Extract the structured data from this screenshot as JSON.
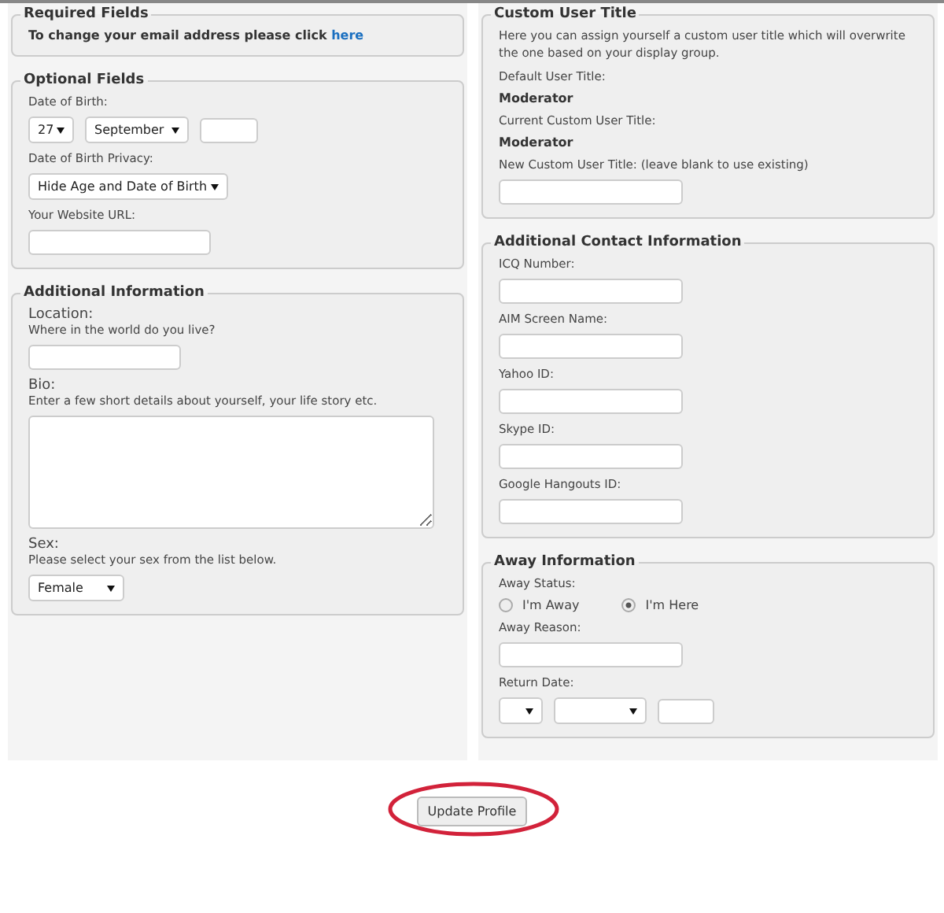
{
  "required_fields": {
    "legend": "Required Fields",
    "text": "To change your email address please click",
    "link": "here"
  },
  "optional_fields": {
    "legend": "Optional Fields",
    "dob_label": "Date of Birth:",
    "dob_day": "27",
    "dob_month": "September",
    "privacy_label": "Date of Birth Privacy:",
    "privacy_value": "Hide Age and Date of Birth",
    "website_label": "Your Website URL:"
  },
  "additional_information": {
    "legend": "Additional Information",
    "location_label": "Location:",
    "location_hint": "Where in the world do you live?",
    "bio_label": "Bio:",
    "bio_hint": "Enter a few short details about yourself, your life story etc.",
    "sex_label": "Sex:",
    "sex_hint": "Please select your sex from the list below.",
    "sex_value": "Female"
  },
  "custom_user_title": {
    "legend": "Custom User Title",
    "description": "Here you can assign yourself a custom user title which will overwrite the one based on your display group.",
    "default_label": "Default User Title:",
    "default_value": "Moderator",
    "current_label": "Current Custom User Title:",
    "current_value": "Moderator",
    "new_label": "New Custom User Title: (leave blank to use existing)"
  },
  "additional_contact_information": {
    "legend": "Additional Contact Information",
    "fields": [
      {
        "label": "ICQ Number:"
      },
      {
        "label": "AIM Screen Name:"
      },
      {
        "label": "Yahoo ID:"
      },
      {
        "label": "Skype ID:"
      },
      {
        "label": "Google Hangouts ID:"
      }
    ]
  },
  "away_information": {
    "legend": "Away Information",
    "status_label": "Away Status:",
    "options": [
      {
        "label": "I'm Away",
        "selected": false
      },
      {
        "label": "I'm Here",
        "selected": true
      }
    ],
    "reason_label": "Away Reason:",
    "return_date_label": "Return Date:"
  },
  "update_button": {
    "label": "Update Profile",
    "highlighted": true
  }
}
